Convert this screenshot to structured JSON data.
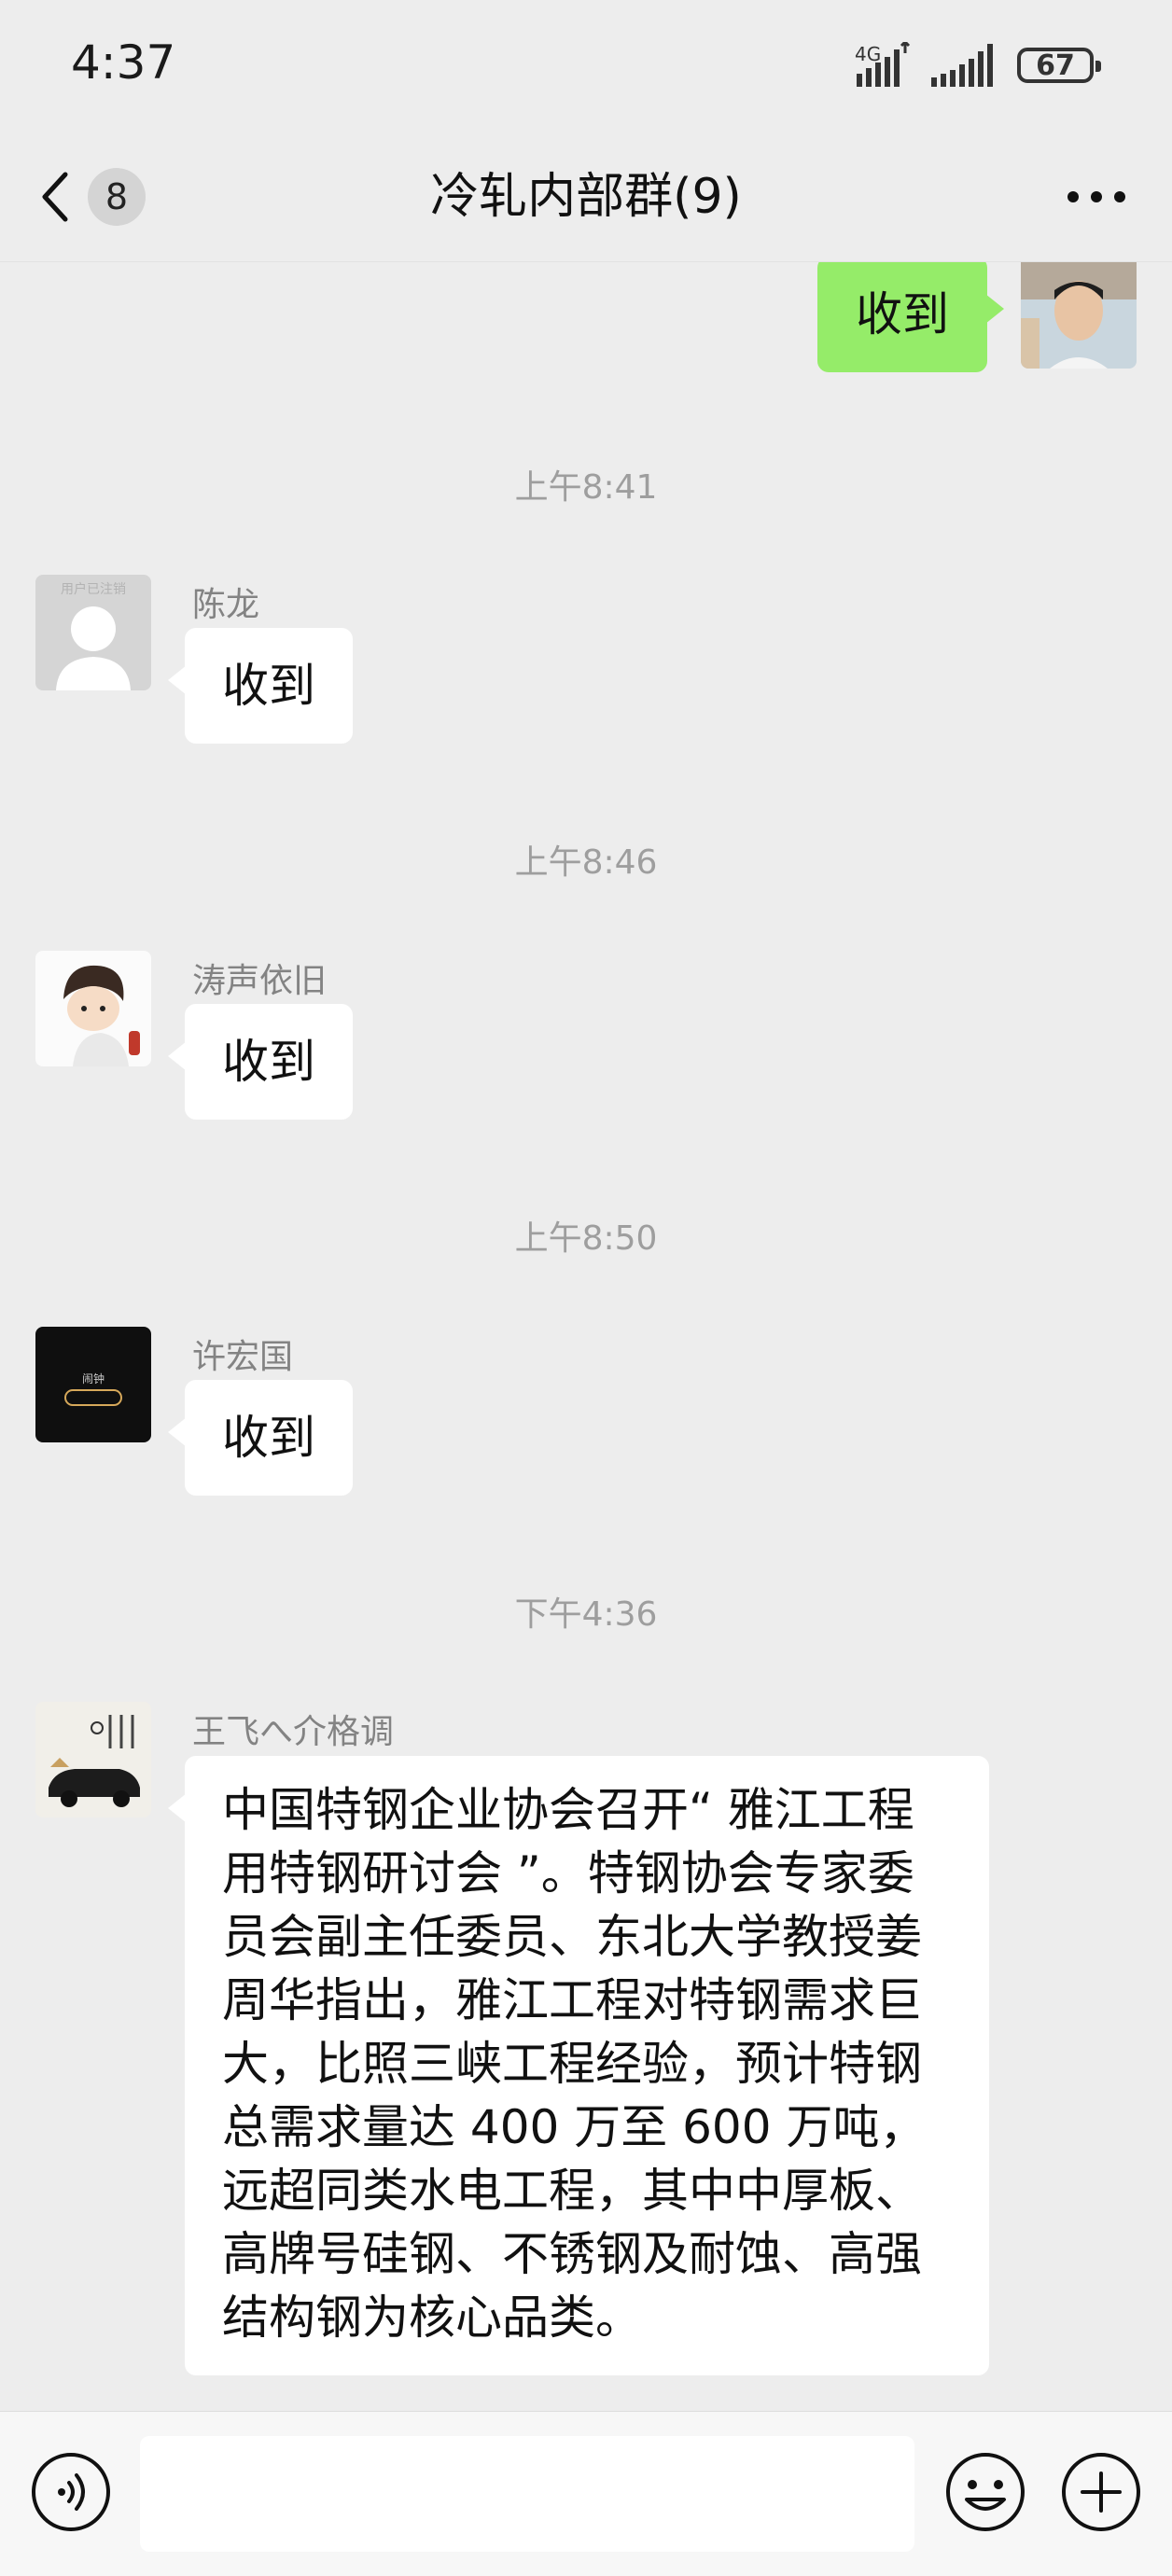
{
  "status_bar": {
    "time": "4:37",
    "network": "4G",
    "battery": "67"
  },
  "header": {
    "unread_count": "8",
    "title": "冷轧内部群(9)"
  },
  "messages": [
    {
      "type": "sent",
      "text": "收到"
    },
    {
      "type": "time",
      "text": "上午8:41"
    },
    {
      "type": "received",
      "sender": "陈龙",
      "avatar_caption": "用户已注销",
      "text": "收到"
    },
    {
      "type": "time",
      "text": "上午8:46"
    },
    {
      "type": "received",
      "sender": "涛声依旧",
      "text": "收到"
    },
    {
      "type": "time",
      "text": "上午8:50"
    },
    {
      "type": "received",
      "sender": "许宏国",
      "avatar_caption": "闹钟",
      "text": "收到"
    },
    {
      "type": "time",
      "text": "下午4:36"
    },
    {
      "type": "received",
      "sender": "王飞へ介格调",
      "text": "中国特钢企业协会召开“ 雅江工程用特钢研讨会 ”。特钢协会专家委员会副主任委员、东北大学教授姜周华指出，雅江工程对特钢需求巨大，比照三峡工程经验，预计特钢总需求量达 400 万至 600 万吨，远超同类水电工程，其中中厚板、高牌号硅钢、不锈钢及耐蚀、高强结构钢为核心品类。"
    }
  ],
  "input_bar": {
    "placeholder": ""
  },
  "colors": {
    "background": "#ededed",
    "sent_bubble": "#95ec69",
    "received_bubble": "#ffffff",
    "timestamp": "#9e9e9e",
    "sender_name": "#838383"
  },
  "icons": {
    "back": "chevron-left-icon",
    "more": "more-dots-icon",
    "voice": "voice-icon",
    "emoji": "emoji-icon",
    "plus": "plus-circle-icon",
    "signal": "signal-icon",
    "battery": "battery-icon"
  }
}
